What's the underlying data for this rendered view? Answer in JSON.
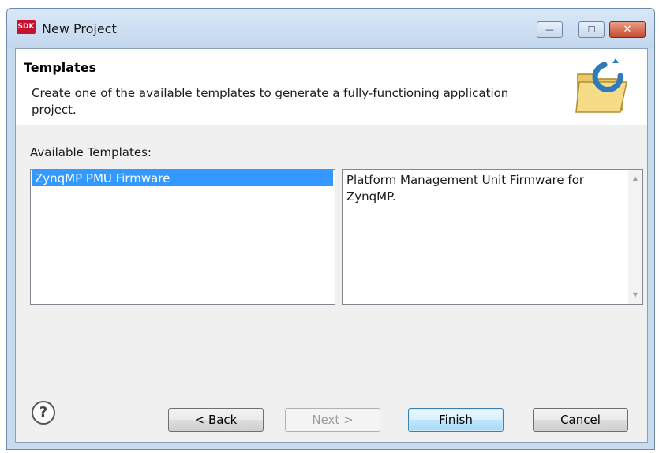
{
  "window": {
    "title": "New Project",
    "app_icon_text": "SDK",
    "minimize_glyph": "—",
    "maximize_glyph": "☐",
    "close_glyph": "✕"
  },
  "header": {
    "title": "Templates",
    "description": "Create one of the available templates to generate a fully-functioning application project.",
    "icon": "open-folder-icon"
  },
  "templates": {
    "label": "Available Templates:",
    "items": [
      {
        "label": "ZynqMP PMU Firmware",
        "selected": true
      }
    ],
    "selection_color": "#3399ff",
    "description": "Platform Management Unit Firmware for ZynqMP."
  },
  "buttons": {
    "help_glyph": "?",
    "back": "< Back",
    "next": "Next >",
    "finish": "Finish",
    "cancel": "Cancel"
  }
}
